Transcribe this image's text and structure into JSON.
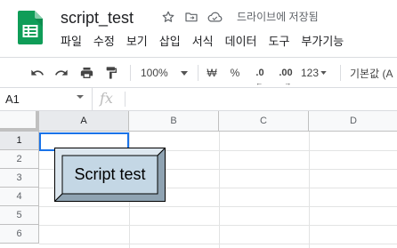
{
  "header": {
    "title": "script_test",
    "save_status": "드라이브에 저장됨",
    "icons": [
      "star-icon",
      "move-to-folder-icon",
      "cloud-done-icon"
    ]
  },
  "menu": [
    "파일",
    "수정",
    "보기",
    "삽입",
    "서식",
    "데이터",
    "도구",
    "부가기능"
  ],
  "toolbar": {
    "zoom": "100%",
    "currency": "₩",
    "percent": "%",
    "decrease_decimal": ".0",
    "increase_decimal": ".00",
    "more_formats": "123",
    "font": "기본값 (A"
  },
  "formula_bar": {
    "name_box": "A1",
    "fx_label": "fx"
  },
  "grid": {
    "columns": [
      "A",
      "B",
      "C",
      "D"
    ],
    "rows": [
      "1",
      "2",
      "3",
      "4",
      "5",
      "6"
    ],
    "selected_cell": "A1"
  },
  "drawing": {
    "label": "Script test",
    "face_color": "#c4d7e5",
    "bevel_light": "#dde7ef",
    "bevel_dark": "#8fa3b2"
  },
  "colors": {
    "selection": "#1a73e8",
    "logo_green": "#0f9d58"
  }
}
